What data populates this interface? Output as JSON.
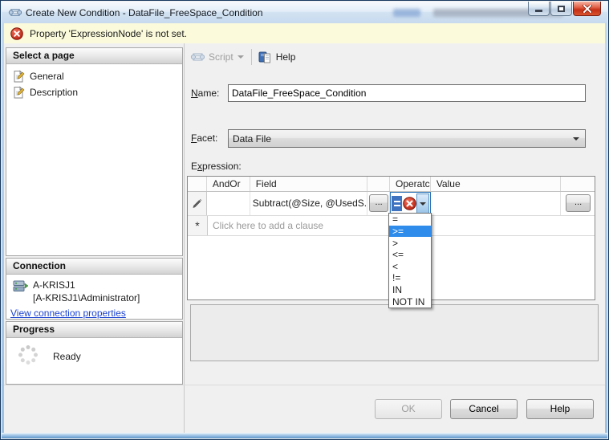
{
  "window": {
    "title": "Create New Condition - DataFile_FreeSpace_Condition",
    "controls": {
      "minimize": "minimize",
      "maximize": "maximize",
      "close": "close"
    }
  },
  "warning": {
    "text": "Property 'ExpressionNode' is not set."
  },
  "sidebar": {
    "select_page": {
      "title": "Select a page",
      "items": [
        {
          "label": "General"
        },
        {
          "label": "Description"
        }
      ]
    },
    "connection": {
      "title": "Connection",
      "server": "A-KRISJ1",
      "user": "[A-KRISJ1\\Administrator]",
      "link": "View connection properties"
    },
    "progress": {
      "title": "Progress",
      "status": "Ready"
    }
  },
  "toolbar": {
    "script_label": "Script",
    "help_label": "Help"
  },
  "form": {
    "name_label": {
      "pre": "",
      "key": "N",
      "post": "ame:"
    },
    "name_value": "DataFile_FreeSpace_Condition",
    "facet_label": {
      "pre": "",
      "key": "F",
      "post": "acet:"
    },
    "facet_value": "Data File",
    "expression_label": {
      "pre": "E",
      "key": "x",
      "post": "pression:"
    }
  },
  "grid": {
    "columns": [
      "",
      "AndOr",
      "Field",
      "",
      "Operatc",
      "Value",
      ""
    ],
    "row": {
      "selector": "pencil",
      "andor": "",
      "field": "Subtract(@Size, @UsedS...",
      "field_ellipsis": "...",
      "operator_chip": "=",
      "value": "",
      "value_ellipsis": "..."
    },
    "new_row": {
      "selector": "*",
      "placeholder": "Click here to add a clause"
    }
  },
  "operator_dropdown": {
    "items": [
      "=",
      ">=",
      ">",
      "<=",
      "<",
      "!=",
      "IN",
      "NOT IN"
    ],
    "selected_index": 1,
    "selected_value": ">="
  },
  "footer": {
    "ok": "OK",
    "cancel": "Cancel",
    "help": "Help"
  },
  "colors": {
    "selection_blue": "#2f8ceb",
    "error_red": "#c52a18",
    "warning_bg": "#fbfbdc",
    "link_blue": "#1c42cf",
    "close_button_red": "#c42f16",
    "titlebar_blue": "#d2e2f2",
    "operator_chip_blue": "#3f73c0"
  }
}
